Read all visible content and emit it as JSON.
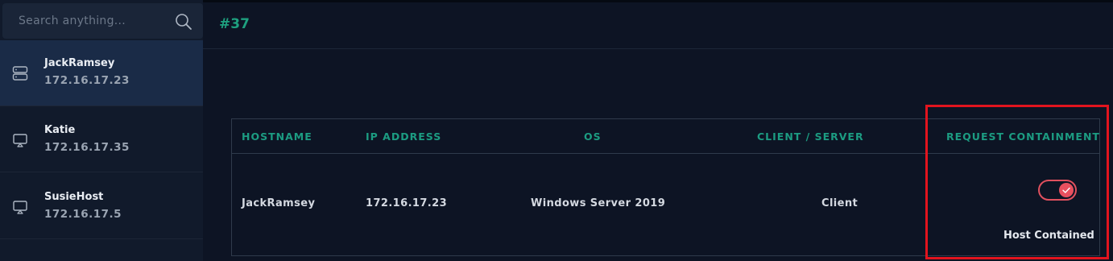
{
  "search": {
    "placeholder": "Search anything..."
  },
  "hosts": [
    {
      "name": "JackRamsey",
      "ip": "172.16.17.23",
      "icon": "server-icon",
      "active": true
    },
    {
      "name": "Katie",
      "ip": "172.16.17.35",
      "icon": "monitor-icon",
      "active": false
    },
    {
      "name": "SusieHost",
      "ip": "172.16.17.5",
      "icon": "monitor-icon",
      "active": false
    }
  ],
  "header": {
    "incident_id": "#37"
  },
  "table": {
    "columns": [
      "HOSTNAME",
      "IP ADDRESS",
      "OS",
      "CLIENT / SERVER",
      "REQUEST CONTAINMENT"
    ],
    "row": {
      "hostname": "JackRamsey",
      "ip": "172.16.17.23",
      "os": "Windows Server 2019",
      "client_server": "Client",
      "containment_enabled": true,
      "containment_status": "Host Contained"
    }
  },
  "colors": {
    "accent": "#1c9c82",
    "toggle": "#e8505f",
    "highlight": "#e2141e",
    "active_item": "#1a2b47"
  }
}
